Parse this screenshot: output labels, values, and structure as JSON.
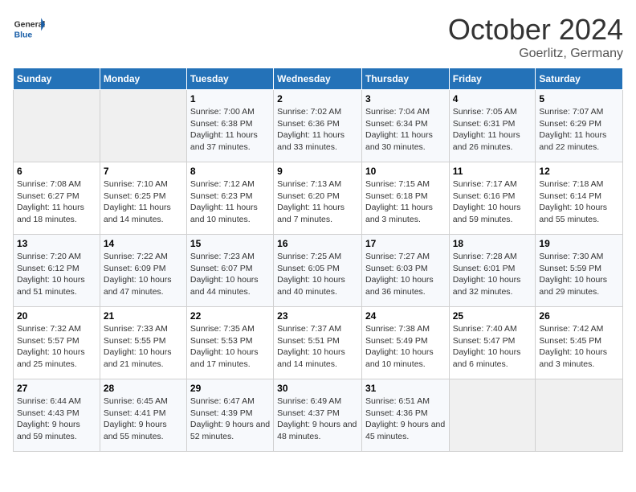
{
  "header": {
    "logo": {
      "general": "General",
      "blue": "Blue"
    },
    "month_title": "October 2024",
    "location": "Goerlitz, Germany"
  },
  "weekdays": [
    "Sunday",
    "Monday",
    "Tuesday",
    "Wednesday",
    "Thursday",
    "Friday",
    "Saturday"
  ],
  "weeks": [
    [
      {
        "day": "",
        "content": ""
      },
      {
        "day": "",
        "content": ""
      },
      {
        "day": "1",
        "content": "Sunrise: 7:00 AM\nSunset: 6:38 PM\nDaylight: 11 hours and 37 minutes."
      },
      {
        "day": "2",
        "content": "Sunrise: 7:02 AM\nSunset: 6:36 PM\nDaylight: 11 hours and 33 minutes."
      },
      {
        "day": "3",
        "content": "Sunrise: 7:04 AM\nSunset: 6:34 PM\nDaylight: 11 hours and 30 minutes."
      },
      {
        "day": "4",
        "content": "Sunrise: 7:05 AM\nSunset: 6:31 PM\nDaylight: 11 hours and 26 minutes."
      },
      {
        "day": "5",
        "content": "Sunrise: 7:07 AM\nSunset: 6:29 PM\nDaylight: 11 hours and 22 minutes."
      }
    ],
    [
      {
        "day": "6",
        "content": "Sunrise: 7:08 AM\nSunset: 6:27 PM\nDaylight: 11 hours and 18 minutes."
      },
      {
        "day": "7",
        "content": "Sunrise: 7:10 AM\nSunset: 6:25 PM\nDaylight: 11 hours and 14 minutes."
      },
      {
        "day": "8",
        "content": "Sunrise: 7:12 AM\nSunset: 6:23 PM\nDaylight: 11 hours and 10 minutes."
      },
      {
        "day": "9",
        "content": "Sunrise: 7:13 AM\nSunset: 6:20 PM\nDaylight: 11 hours and 7 minutes."
      },
      {
        "day": "10",
        "content": "Sunrise: 7:15 AM\nSunset: 6:18 PM\nDaylight: 11 hours and 3 minutes."
      },
      {
        "day": "11",
        "content": "Sunrise: 7:17 AM\nSunset: 6:16 PM\nDaylight: 10 hours and 59 minutes."
      },
      {
        "day": "12",
        "content": "Sunrise: 7:18 AM\nSunset: 6:14 PM\nDaylight: 10 hours and 55 minutes."
      }
    ],
    [
      {
        "day": "13",
        "content": "Sunrise: 7:20 AM\nSunset: 6:12 PM\nDaylight: 10 hours and 51 minutes."
      },
      {
        "day": "14",
        "content": "Sunrise: 7:22 AM\nSunset: 6:09 PM\nDaylight: 10 hours and 47 minutes."
      },
      {
        "day": "15",
        "content": "Sunrise: 7:23 AM\nSunset: 6:07 PM\nDaylight: 10 hours and 44 minutes."
      },
      {
        "day": "16",
        "content": "Sunrise: 7:25 AM\nSunset: 6:05 PM\nDaylight: 10 hours and 40 minutes."
      },
      {
        "day": "17",
        "content": "Sunrise: 7:27 AM\nSunset: 6:03 PM\nDaylight: 10 hours and 36 minutes."
      },
      {
        "day": "18",
        "content": "Sunrise: 7:28 AM\nSunset: 6:01 PM\nDaylight: 10 hours and 32 minutes."
      },
      {
        "day": "19",
        "content": "Sunrise: 7:30 AM\nSunset: 5:59 PM\nDaylight: 10 hours and 29 minutes."
      }
    ],
    [
      {
        "day": "20",
        "content": "Sunrise: 7:32 AM\nSunset: 5:57 PM\nDaylight: 10 hours and 25 minutes."
      },
      {
        "day": "21",
        "content": "Sunrise: 7:33 AM\nSunset: 5:55 PM\nDaylight: 10 hours and 21 minutes."
      },
      {
        "day": "22",
        "content": "Sunrise: 7:35 AM\nSunset: 5:53 PM\nDaylight: 10 hours and 17 minutes."
      },
      {
        "day": "23",
        "content": "Sunrise: 7:37 AM\nSunset: 5:51 PM\nDaylight: 10 hours and 14 minutes."
      },
      {
        "day": "24",
        "content": "Sunrise: 7:38 AM\nSunset: 5:49 PM\nDaylight: 10 hours and 10 minutes."
      },
      {
        "day": "25",
        "content": "Sunrise: 7:40 AM\nSunset: 5:47 PM\nDaylight: 10 hours and 6 minutes."
      },
      {
        "day": "26",
        "content": "Sunrise: 7:42 AM\nSunset: 5:45 PM\nDaylight: 10 hours and 3 minutes."
      }
    ],
    [
      {
        "day": "27",
        "content": "Sunrise: 6:44 AM\nSunset: 4:43 PM\nDaylight: 9 hours and 59 minutes."
      },
      {
        "day": "28",
        "content": "Sunrise: 6:45 AM\nSunset: 4:41 PM\nDaylight: 9 hours and 55 minutes."
      },
      {
        "day": "29",
        "content": "Sunrise: 6:47 AM\nSunset: 4:39 PM\nDaylight: 9 hours and 52 minutes."
      },
      {
        "day": "30",
        "content": "Sunrise: 6:49 AM\nSunset: 4:37 PM\nDaylight: 9 hours and 48 minutes."
      },
      {
        "day": "31",
        "content": "Sunrise: 6:51 AM\nSunset: 4:36 PM\nDaylight: 9 hours and 45 minutes."
      },
      {
        "day": "",
        "content": ""
      },
      {
        "day": "",
        "content": ""
      }
    ]
  ]
}
